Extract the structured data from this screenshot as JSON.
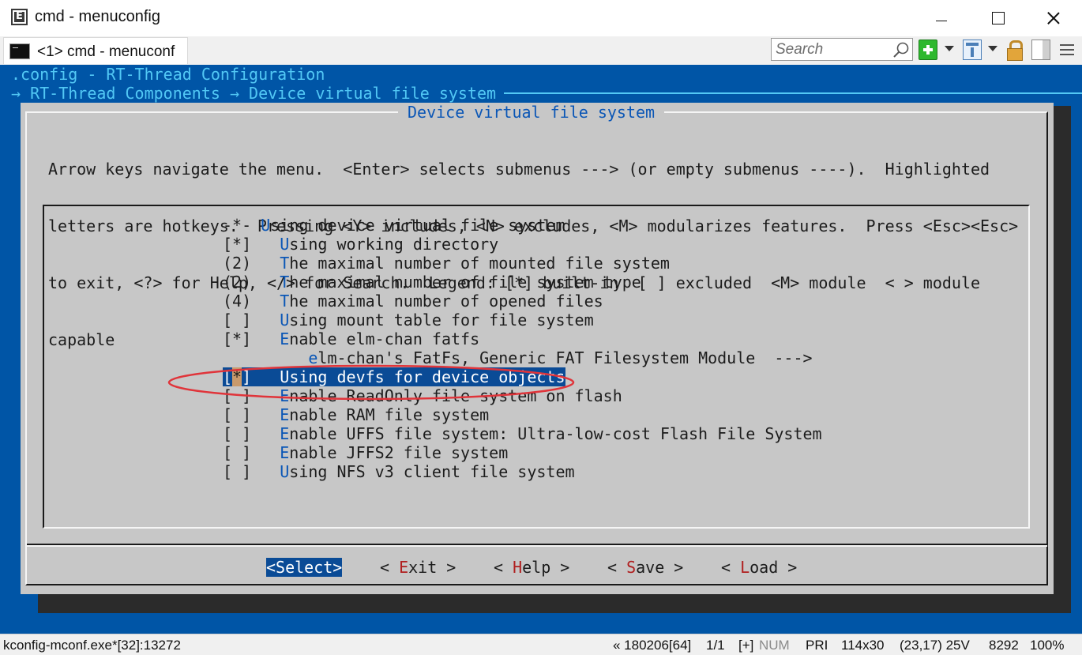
{
  "window": {
    "title": "cmd - menuconfig",
    "tab_label": "<1> cmd - menuconf"
  },
  "toolbar": {
    "search_placeholder": "Search",
    "icons": [
      "search-icon",
      "new-console-icon",
      "view-icon",
      "lock-icon",
      "panel-icon",
      "menu-icon"
    ]
  },
  "console": {
    "config_line": ".config - RT-Thread Configuration",
    "breadcrumb": "→ RT-Thread Components → Device virtual file system"
  },
  "dialog": {
    "title": "Device virtual file system",
    "help_lines": [
      "Arrow keys navigate the menu.  <Enter> selects submenus ---> (or empty submenus ----).  Highlighted",
      "letters are hotkeys.  Pressing <Y> includes, <N> excludes, <M> modularizes features.  Press <Esc><Esc>",
      "to exit, <?> for Help, </> for Search.  Legend: [*] built-in  [ ] excluded  <M> module  < > module",
      "capable"
    ]
  },
  "menu": {
    "items": [
      {
        "prefix": "-*- ",
        "hotkey": "U",
        "rest": "sing device virtual file system"
      },
      {
        "prefix": "[*]   ",
        "hotkey": "U",
        "rest": "sing working directory"
      },
      {
        "prefix": "(2)   ",
        "hotkey": "T",
        "rest": "he maximal number of mounted file system"
      },
      {
        "prefix": "(2)   ",
        "hotkey": "T",
        "rest": "he maximal number of file system type"
      },
      {
        "prefix": "(4)   ",
        "hotkey": "T",
        "rest": "he maximal number of opened files"
      },
      {
        "prefix": "[ ]   ",
        "hotkey": "U",
        "rest": "sing mount table for file system"
      },
      {
        "prefix": "[*]   ",
        "hotkey": "E",
        "rest": "nable elm-chan fatfs"
      },
      {
        "prefix": "         ",
        "hotkey": "e",
        "rest": "lm-chan's FatFs, Generic FAT Filesystem Module  --->"
      },
      {
        "prefix": "[*]   ",
        "hotkey": "U",
        "rest": "sing devfs for device objects",
        "selected": true
      },
      {
        "prefix": "[ ]   ",
        "hotkey": "E",
        "rest": "nable ReadOnly file system on flash"
      },
      {
        "prefix": "[ ]   ",
        "hotkey": "E",
        "rest": "nable RAM file system"
      },
      {
        "prefix": "[ ]   ",
        "hotkey": "E",
        "rest": "nable UFFS file system: Ultra-low-cost Flash File System"
      },
      {
        "prefix": "[ ]   ",
        "hotkey": "E",
        "rest": "nable JFFS2 file system"
      },
      {
        "prefix": "[ ]   ",
        "hotkey": "U",
        "rest": "sing NFS v3 client file system"
      }
    ]
  },
  "buttons": {
    "select": {
      "open": "<",
      "hotkey": "S",
      "rest": "elect>"
    },
    "exit": {
      "open": "< ",
      "hotkey": "E",
      "rest": "xit >"
    },
    "help": {
      "open": "< ",
      "hotkey": "H",
      "rest": "elp >"
    },
    "save": {
      "open": "< ",
      "hotkey": "S",
      "rest": "ave >"
    },
    "load": {
      "open": "< ",
      "hotkey": "L",
      "rest": "oad >"
    }
  },
  "status": {
    "process": "kconfig-mconf.exe*[32]:13272",
    "session": "« 180206[64]",
    "page": "1/1",
    "mode": "[+]",
    "num": "NUM",
    "pri": "PRI",
    "size": "114x30",
    "cursor": "(23,17) 25V",
    "pid": "8292",
    "zoom": "100%"
  },
  "colors": {
    "console_bg": "#0055a6",
    "dialog_bg": "#c7c7c7",
    "highlight": "#0a4b96",
    "hotkey": "#0a56b6",
    "button_hotkey": "#b01f1f",
    "header_text": "#52c8f5",
    "annotation": "#e0343a"
  }
}
